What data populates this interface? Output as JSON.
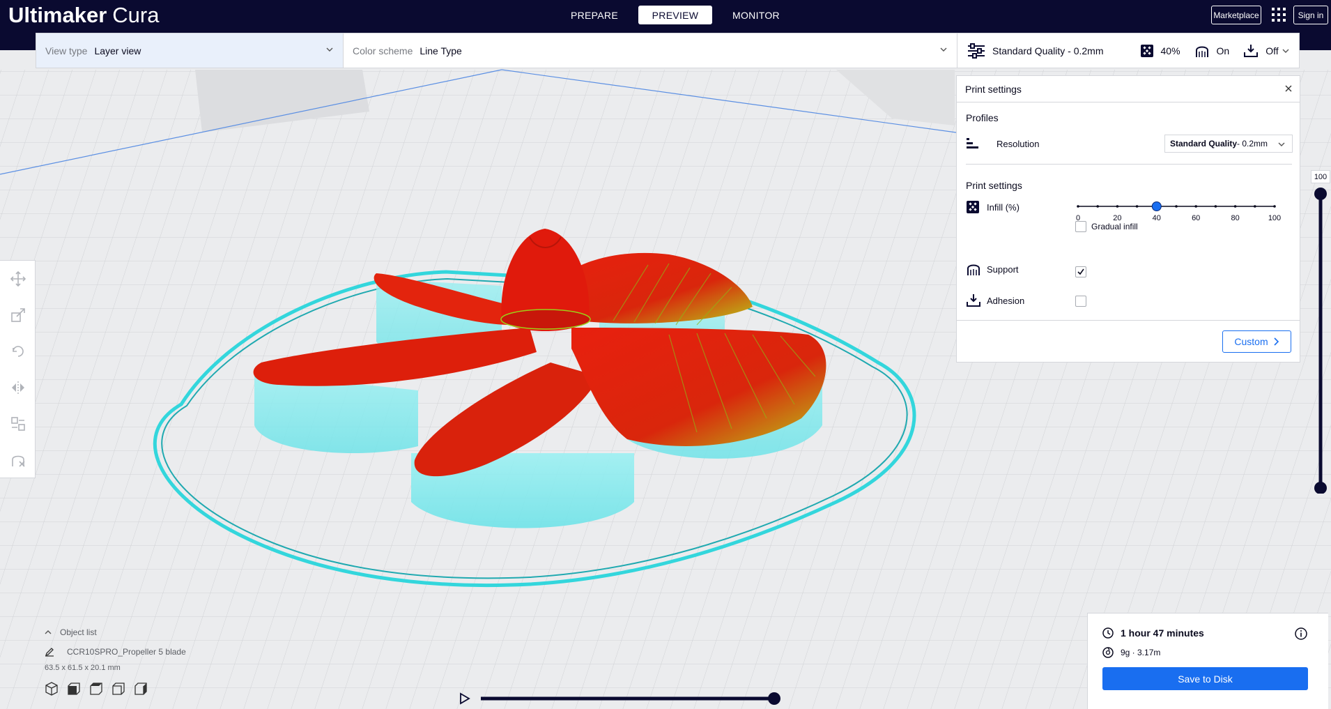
{
  "app": {
    "brand_bold": "Ultimaker",
    "brand_light": "Cura"
  },
  "stages": [
    {
      "label": "PREPARE",
      "active": false
    },
    {
      "label": "PREVIEW",
      "active": true
    },
    {
      "label": "MONITOR",
      "active": false
    }
  ],
  "header": {
    "marketplace": "Marketplace",
    "sign_in": "Sign in"
  },
  "stagebar": {
    "view_type_label": "View type",
    "view_type_value": "Layer view",
    "color_scheme_label": "Color scheme",
    "color_scheme_value": "Line Type",
    "quality": "Standard Quality - 0.2mm",
    "infill": "40%",
    "support": "On",
    "adhesion": "Off"
  },
  "print_settings": {
    "title": "Print settings",
    "profiles_heading": "Profiles",
    "resolution_label": "Resolution",
    "resolution_value_bold": "Standard Quality",
    "resolution_value_rest": " - 0.2mm",
    "settings_heading": "Print settings",
    "infill_label": "Infill (%)",
    "infill_value": 40,
    "infill_ticks": [
      "0",
      "20",
      "40",
      "60",
      "80",
      "100"
    ],
    "gradual_infill_label": "Gradual infill",
    "gradual_infill_checked": false,
    "support_label": "Support",
    "support_checked": true,
    "adhesion_label": "Adhesion",
    "adhesion_checked": false,
    "custom_button": "Custom"
  },
  "layer_slider": {
    "top_value": "100"
  },
  "object_list": {
    "toggle_label": "Object list",
    "object_name": "CCR10SPRO_Propeller 5 blade",
    "dimensions": "63.5 x 61.5 x 20.1 mm"
  },
  "print_info": {
    "time": "1 hour 47 minutes",
    "material": "9g · 3.17m",
    "save_button": "Save to Disk"
  },
  "colors": {
    "header_bg": "#0a0a30",
    "accent_blue": "#196ef0",
    "model_red": "#e01a0c",
    "skirt_cyan": "#3ee6ea"
  }
}
